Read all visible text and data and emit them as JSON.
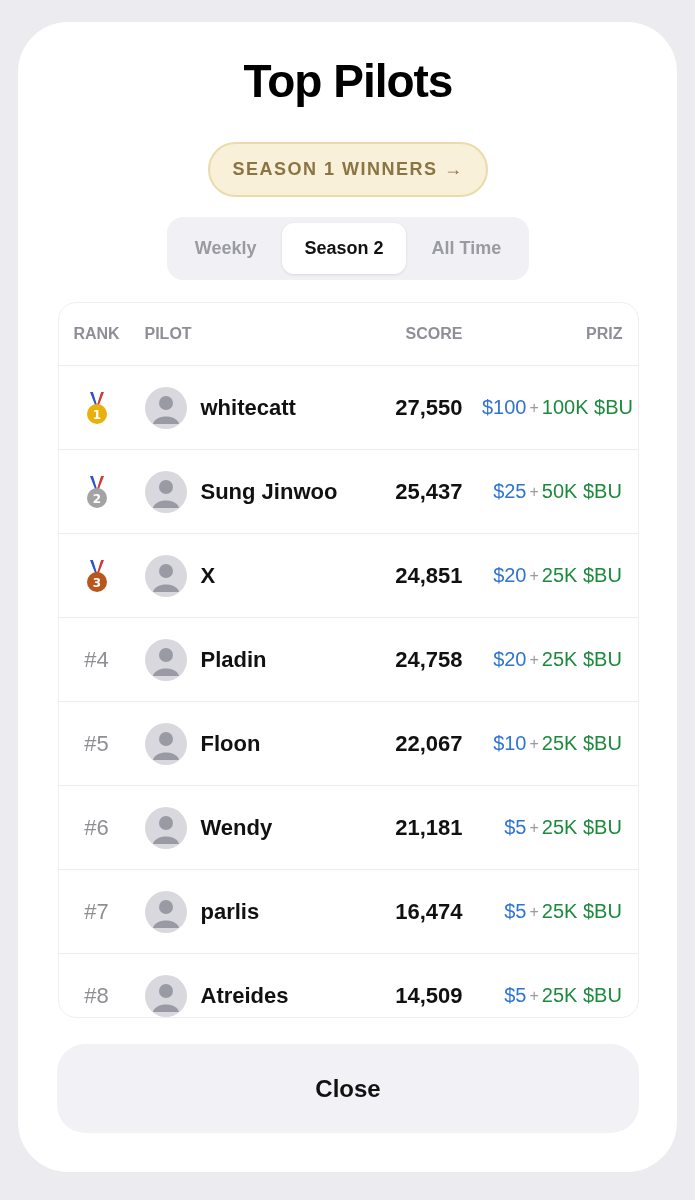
{
  "title": "Top Pilots",
  "season_link": "SEASON 1 WINNERS →",
  "tabs": [
    {
      "label": "Weekly",
      "selected": false
    },
    {
      "label": "Season 2",
      "selected": true
    },
    {
      "label": "All Time",
      "selected": false
    }
  ],
  "columns": [
    "RANK",
    "PILOT",
    "SCORE",
    "PRIZ"
  ],
  "rows": [
    {
      "kind": "medal",
      "rank": "1",
      "color": "#e8b10e",
      "name": "whitecatt",
      "score": "27,550",
      "usd": "$100",
      "plus": "+",
      "token": "100K $BU"
    },
    {
      "kind": "medal",
      "rank": "2",
      "color": "#a3a3a3",
      "name": "Sung Jinwoo",
      "score": "25,437",
      "usd": "$25",
      "plus": "+",
      "token": "50K $BU"
    },
    {
      "kind": "medal",
      "rank": "3",
      "color": "#b8561c",
      "name": "X",
      "score": "24,851",
      "usd": "$20",
      "plus": "+",
      "token": "25K $BU"
    },
    {
      "kind": "number",
      "rank": "#4",
      "name": "Pladin",
      "score": "24,758",
      "usd": "$20",
      "plus": "+",
      "token": "25K $BU"
    },
    {
      "kind": "number",
      "rank": "#5",
      "name": "Floon",
      "score": "22,067",
      "usd": "$10",
      "plus": "+",
      "token": "25K $BU"
    },
    {
      "kind": "number",
      "rank": "#6",
      "name": "Wendy",
      "score": "21,181",
      "usd": "$5",
      "plus": "+",
      "token": "25K $BU"
    },
    {
      "kind": "number",
      "rank": "#7",
      "name": "parlis",
      "score": "16,474",
      "usd": "$5",
      "plus": "+",
      "token": "25K $BU"
    },
    {
      "kind": "number",
      "rank": "#8",
      "name": "Atreides",
      "score": "14,509",
      "usd": "$5",
      "plus": "+",
      "token": "25K $BU"
    }
  ],
  "close_button": "Close"
}
